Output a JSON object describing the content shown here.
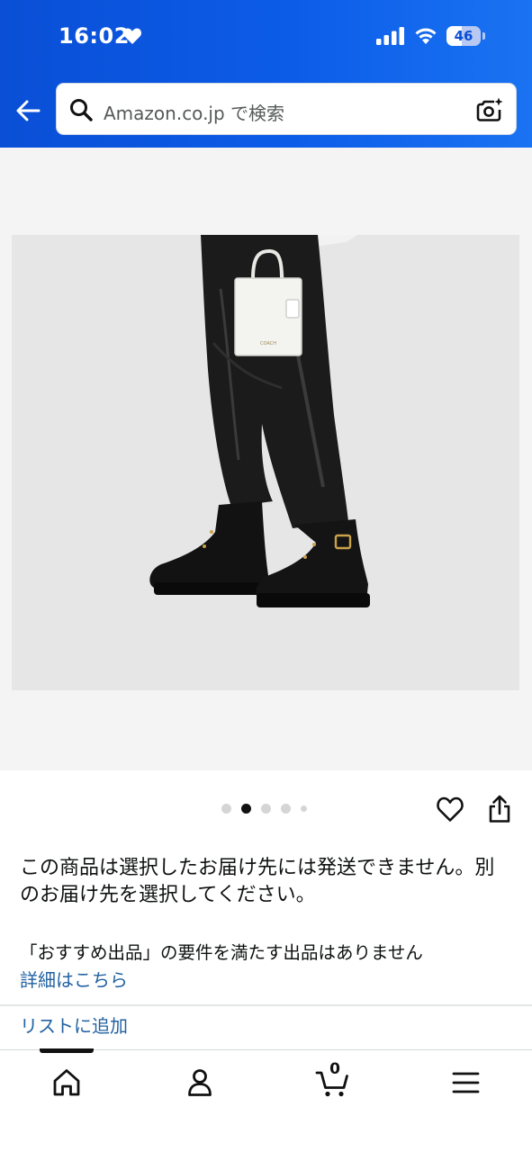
{
  "status_bar": {
    "time": "16:02",
    "battery": "46",
    "battery_level_percent": 46
  },
  "search": {
    "placeholder": "Amazon.co.jp で検索"
  },
  "gallery": {
    "image_count": 5,
    "active_index": 1,
    "image_alt": "COACH バッグ 商品画像"
  },
  "notice": {
    "text": "この商品は選択したお届け先には発送できません。別のお届け先を選択してください。"
  },
  "recommended": {
    "text": "「おすすめ出品」の要件を満たす出品はありません",
    "details_link": "詳細はこちら"
  },
  "add_to_list": "リストに追加",
  "cart": {
    "count": "0"
  },
  "colors": {
    "header_blue": "#0a4fd6",
    "link_blue": "#2162a1"
  },
  "icons": [
    "heart-icon",
    "signal-icon",
    "wifi-icon",
    "battery-icon",
    "back-arrow-icon",
    "search-icon",
    "camera-icon",
    "favorite-heart-icon",
    "share-icon",
    "home-icon",
    "account-icon",
    "cart-icon",
    "menu-icon"
  ]
}
